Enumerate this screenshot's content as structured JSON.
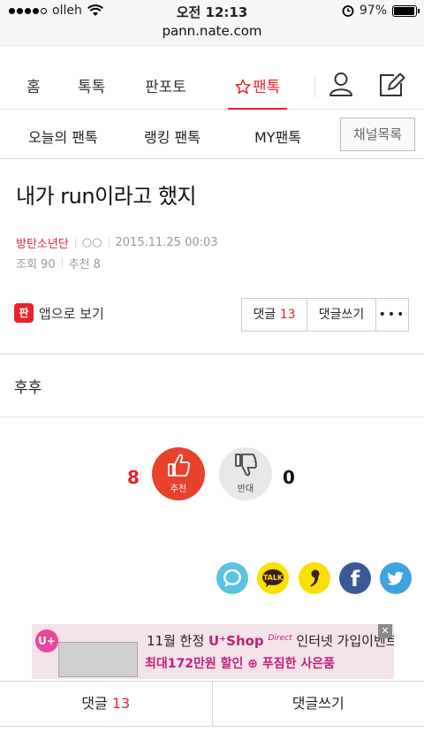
{
  "status_bar": {
    "carrier": "olleh",
    "time": "오전 12:13",
    "battery": "97%",
    "battery_level": 0.97
  },
  "browser": {
    "url": "pann.nate.com"
  },
  "main_nav": {
    "items": [
      "홈",
      "톡톡",
      "판포토",
      "팬톡"
    ],
    "active": "팬톡",
    "accent_color": "#e8222b"
  },
  "sub_nav": {
    "items": [
      "오늘의 팬톡",
      "랭킹 팬톡",
      "MY팬톡"
    ],
    "channel_button": "채널목록"
  },
  "article": {
    "title": "내가 run이라고 했지",
    "author": "방탄소년단",
    "author_extra": "○○",
    "datetime": "2015.11.25 00:03",
    "views_label": "조회 90",
    "recommend_label": "추천 8",
    "app_view_label": "앱으로 보기",
    "app_icon_text": "판",
    "comment_label": "댓글",
    "comment_count": "13",
    "write_comment_label": "댓글쓰기",
    "more_label": "•••",
    "body": "후후"
  },
  "vote": {
    "up_count": "8",
    "up_label": "추천",
    "down_count": "0",
    "down_label": "반대"
  },
  "share_icons": [
    "chat-bubble-icon",
    "kakaotalk-icon",
    "kakaostory-icon",
    "facebook-icon",
    "twitter-icon"
  ],
  "share_labels": {
    "kakao": "TALK",
    "facebook": "f"
  },
  "ad": {
    "logo": "U+",
    "line1_prefix": "11월 한정",
    "brand": "U⁺Shop",
    "brand_tag": "Direct",
    "line1_suffix": "인터넷 가입이벤트",
    "line2": "최대172만원 할인 ⊕ 푸짐한 사은품",
    "close": "✕"
  },
  "bottom_bar": {
    "comment_label": "댓글",
    "comment_count": "13",
    "write_label": "댓글쓰기"
  }
}
